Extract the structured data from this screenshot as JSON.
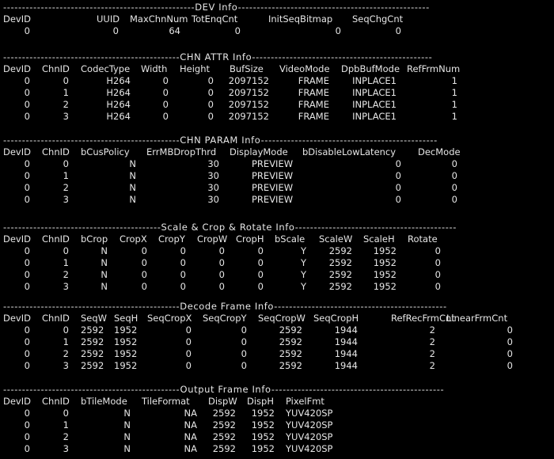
{
  "theme": {
    "background": "#000000",
    "text": "#e6e6e6"
  },
  "sections": [
    {
      "id": "dev-info",
      "separator": "---------------------------------------------------DEV Info---------------------------------------------------",
      "headers": [
        "DevID",
        "UUID",
        "MaxChnNum",
        "TotEnqCnt",
        "InitSeqBitmap",
        "SeqChgCnt"
      ],
      "rows": [
        [
          "0",
          "0",
          "64",
          "0",
          "0",
          "0"
        ]
      ]
    },
    {
      "id": "chn-attr-info",
      "separator": "-----------------------------------------------CHN ATTR Info------------------------------------------------",
      "headers": [
        "DevID",
        "ChnID",
        "CodecType",
        "Width",
        "Height",
        "BufSize",
        "VideoMode",
        "DpbBufMode",
        "RefFrmNum"
      ],
      "rows": [
        [
          "0",
          "0",
          "H264",
          "0",
          "0",
          "2097152",
          "FRAME",
          "INPLACE1",
          "1"
        ],
        [
          "0",
          "1",
          "H264",
          "0",
          "0",
          "2097152",
          "FRAME",
          "INPLACE1",
          "1"
        ],
        [
          "0",
          "2",
          "H264",
          "0",
          "0",
          "2097152",
          "FRAME",
          "INPLACE1",
          "1"
        ],
        [
          "0",
          "3",
          "H264",
          "0",
          "0",
          "2097152",
          "FRAME",
          "INPLACE1",
          "1"
        ]
      ]
    },
    {
      "id": "chn-param-info",
      "separator": "-----------------------------------------------CHN PARAM Info-----------------------------------------------",
      "headers": [
        "DevID",
        "ChnID",
        "bCusPolicy",
        "ErrMBDropThrd",
        "DisplayMode",
        "bDisableLowLatency",
        "DecMode"
      ],
      "rows": [
        [
          "0",
          "0",
          "N",
          "30",
          "PREVIEW",
          "0",
          "0"
        ],
        [
          "0",
          "1",
          "N",
          "30",
          "PREVIEW",
          "0",
          "0"
        ],
        [
          "0",
          "2",
          "N",
          "30",
          "PREVIEW",
          "0",
          "0"
        ],
        [
          "0",
          "3",
          "N",
          "30",
          "PREVIEW",
          "0",
          "0"
        ]
      ]
    },
    {
      "id": "scale-crop-rotate-info",
      "separator": "------------------------------------------Scale & Crop & Rotate Info-------------------------------------------",
      "headers": [
        "DevID",
        "ChnID",
        "bCrop",
        "CropX",
        "CropY",
        "CropW",
        "CropH",
        "bScale",
        "ScaleW",
        "ScaleH",
        "Rotate"
      ],
      "rows": [
        [
          "0",
          "0",
          "N",
          "0",
          "0",
          "0",
          "0",
          "Y",
          "2592",
          "1952",
          "0"
        ],
        [
          "0",
          "1",
          "N",
          "0",
          "0",
          "0",
          "0",
          "Y",
          "2592",
          "1952",
          "0"
        ],
        [
          "0",
          "2",
          "N",
          "0",
          "0",
          "0",
          "0",
          "Y",
          "2592",
          "1952",
          "0"
        ],
        [
          "0",
          "3",
          "N",
          "0",
          "0",
          "0",
          "0",
          "Y",
          "2592",
          "1952",
          "0"
        ]
      ]
    },
    {
      "id": "decode-frame-info",
      "separator": "-----------------------------------------------Decode Frame Info----------------------------------------------",
      "headers": [
        "DevID",
        "ChnID",
        "SeqW",
        "SeqH",
        "SeqCropX",
        "SeqCropY",
        "SeqCropW",
        "SeqCropH",
        "RefRecFrmCnt",
        "LinearFrmCnt"
      ],
      "rows": [
        [
          "0",
          "0",
          "2592",
          "1952",
          "0",
          "0",
          "2592",
          "1944",
          "2",
          "0"
        ],
        [
          "0",
          "1",
          "2592",
          "1952",
          "0",
          "0",
          "2592",
          "1944",
          "2",
          "0"
        ],
        [
          "0",
          "2",
          "2592",
          "1952",
          "0",
          "0",
          "2592",
          "1944",
          "2",
          "0"
        ],
        [
          "0",
          "3",
          "2592",
          "1952",
          "0",
          "0",
          "2592",
          "1944",
          "2",
          "0"
        ]
      ]
    },
    {
      "id": "output-frame-info",
      "separator": "-----------------------------------------------Output Frame Info----------------------------------------------",
      "headers": [
        "DevID",
        "ChnID",
        "bTileMode",
        "TileFormat",
        "DispW",
        "DispH",
        "PixelFmt"
      ],
      "rows": [
        [
          "0",
          "0",
          "N",
          "NA",
          "2592",
          "1952",
          "YUV420SP"
        ],
        [
          "0",
          "1",
          "N",
          "NA",
          "2592",
          "1952",
          "YUV420SP"
        ],
        [
          "0",
          "2",
          "N",
          "NA",
          "2592",
          "1952",
          "YUV420SP"
        ],
        [
          "0",
          "3",
          "N",
          "NA",
          "2592",
          "1952",
          "YUV420SP"
        ]
      ]
    }
  ]
}
